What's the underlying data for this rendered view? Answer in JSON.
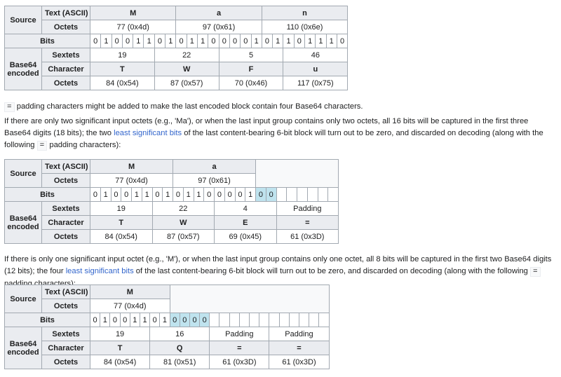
{
  "labels": {
    "source": "Source",
    "text_ascii": "Text (ASCII)",
    "octets": "Octets",
    "bits": "Bits",
    "base64_line1": "Base64",
    "base64_line2": "encoded",
    "sextets": "Sextets",
    "character": "Character",
    "padding": "Padding"
  },
  "table1": {
    "text": [
      "M",
      "a",
      "n"
    ],
    "octets": [
      "77 (0x4d)",
      "97 (0x61)",
      "110 (0x6e)"
    ],
    "bits": [
      "0",
      "1",
      "0",
      "0",
      "1",
      "1",
      "0",
      "1",
      "0",
      "1",
      "1",
      "0",
      "0",
      "0",
      "0",
      "1",
      "0",
      "1",
      "1",
      "0",
      "1",
      "1",
      "1",
      "0"
    ],
    "sextets": [
      "19",
      "22",
      "5",
      "46"
    ],
    "characters": [
      "T",
      "W",
      "F",
      "u"
    ],
    "out_octets": [
      "84 (0x54)",
      "87 (0x57)",
      "70 (0x46)",
      "117 (0x75)"
    ]
  },
  "para1": {
    "code": "=",
    "text": " padding characters might be added to make the last encoded block contain four Base64 characters."
  },
  "para2": {
    "a": "If there are only two significant input octets (e.g., 'Ma'), or when the last input group contains only two octets, all 16 bits will be captured in the first three Base64 digits (18 bits); the two ",
    "link": "least significant bits",
    "b": " of the last content-bearing 6-bit block will turn out to be zero, and discarded on decoding (along with the following ",
    "code": "=",
    "c": " padding characters):"
  },
  "table2": {
    "text": [
      "M",
      "a"
    ],
    "octets": [
      "77 (0x4d)",
      "97 (0x61)"
    ],
    "bits": [
      "0",
      "1",
      "0",
      "0",
      "1",
      "1",
      "0",
      "1",
      "0",
      "1",
      "1",
      "0",
      "0",
      "0",
      "0",
      "1",
      "0",
      "0"
    ],
    "sextets": [
      "19",
      "22",
      "4"
    ],
    "characters": [
      "T",
      "W",
      "E",
      "="
    ],
    "out_octets": [
      "84 (0x54)",
      "87 (0x57)",
      "69 (0x45)",
      "61 (0x3D)"
    ]
  },
  "para3": {
    "a": "If there is only one significant input octet (e.g., 'M'), or when the last input group contains only one octet, all 8 bits will be captured in the first two Base64 digits (12 bits); the four ",
    "link": "least significant bits",
    "b": " of the last content-bearing 6-bit block will turn out to be zero, and discarded on decoding (along with the following ",
    "code": "=",
    "c": " padding characters):"
  },
  "table3": {
    "text": [
      "M"
    ],
    "octets": [
      "77 (0x4d)"
    ],
    "bits": [
      "0",
      "1",
      "0",
      "0",
      "1",
      "1",
      "0",
      "1",
      "0",
      "0",
      "0",
      "0"
    ],
    "sextets": [
      "19",
      "16"
    ],
    "characters": [
      "T",
      "Q",
      "=",
      "="
    ],
    "out_octets": [
      "84 (0x54)",
      "81 (0x51)",
      "61 (0x3D)",
      "61 (0x3D)"
    ]
  }
}
